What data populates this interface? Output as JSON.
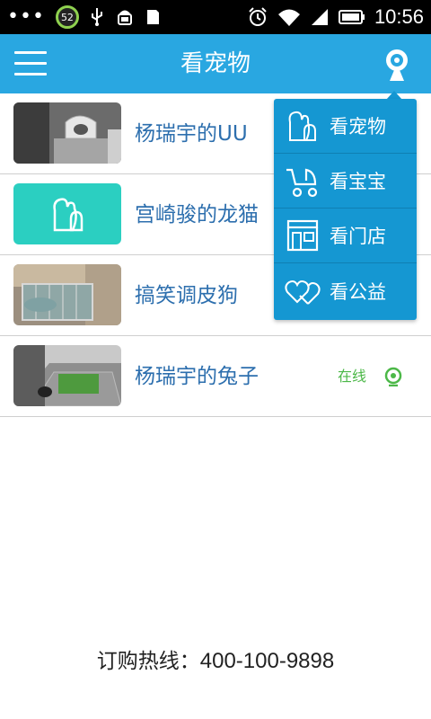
{
  "status_bar": {
    "battery_badge": "52",
    "time": "10:56"
  },
  "header": {
    "title": "看宠物"
  },
  "list": [
    {
      "title": "杨瑞宇的UU",
      "status": ""
    },
    {
      "title": "宫崎骏的龙猫",
      "status": ""
    },
    {
      "title": "搞笑调皮狗",
      "status": ""
    },
    {
      "title": "杨瑞宇的兔子",
      "status": "在线"
    }
  ],
  "dropdown": [
    {
      "label": "看宠物",
      "icon": "pets-icon"
    },
    {
      "label": "看宝宝",
      "icon": "stroller-icon"
    },
    {
      "label": "看门店",
      "icon": "store-icon"
    },
    {
      "label": "看公益",
      "icon": "hearts-icon"
    }
  ],
  "footer": {
    "hotline_label": "订购热线：",
    "hotline_number": "400-100-9898"
  },
  "colors": {
    "primary": "#29a7e1",
    "dropdown": "#1597d2",
    "online": "#4cb848",
    "title_text": "#2d6fae",
    "teal_thumb": "#2bcfc1"
  }
}
